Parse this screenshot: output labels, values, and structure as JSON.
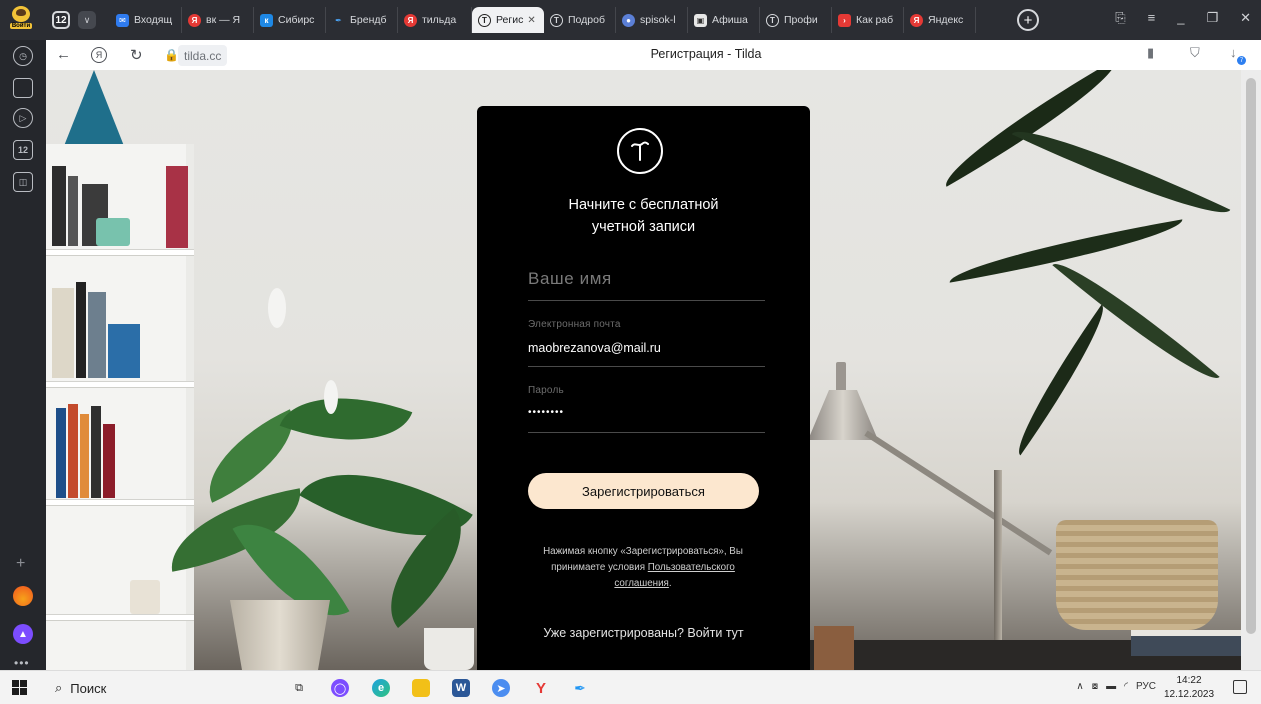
{
  "browser": {
    "login_label": "Войти",
    "tab_count": "12",
    "tabs": [
      {
        "label": "Входящ",
        "color": "#2f7bef"
      },
      {
        "label": "вк — Я",
        "color": "#e53935"
      },
      {
        "label": "Сибирс",
        "color": "#1e88e5"
      },
      {
        "label": "Брендб",
        "color": "#2196f3"
      },
      {
        "label": "тильда",
        "color": "#e53935"
      },
      {
        "label": "Регис",
        "color": "#222222",
        "active": true
      },
      {
        "label": "Подроб",
        "color": "#222222"
      },
      {
        "label": "spisok-l",
        "color": "#5b7fd6"
      },
      {
        "label": "Афиша",
        "color": "#333333"
      },
      {
        "label": "Профи",
        "color": "#222222"
      },
      {
        "label": "Как раб",
        "color": "#e53935"
      },
      {
        "label": "Яндекс",
        "color": "#e53935"
      }
    ],
    "url": "tilda.cc",
    "page_title": "Регистрация - Tilda",
    "download_count": "7"
  },
  "form": {
    "heading_line1": "Начните с бесплатной",
    "heading_line2": "учетной записи",
    "name_placeholder": "Ваше имя",
    "email_label": "Электронная почта",
    "email_value": "maobrezanova@mail.ru",
    "password_label": "Пароль",
    "password_value": "••••••••",
    "submit_label": "Зарегистрироваться",
    "legal_prefix": "Нажимая кнопку «Зарегистрироваться», Вы принимаете условия ",
    "legal_link": "Пользовательского соглашения",
    "legal_suffix": ".",
    "login_link": "Уже зарегистрированы? Войти тут"
  },
  "taskbar": {
    "search_label": "Поиск",
    "lang": "РУС",
    "time": "14:22",
    "date": "12.12.2023"
  },
  "colors": {
    "card_bg": "#000000",
    "cta_bg": "#fce7cf",
    "accent_download": "#2d7ff0"
  }
}
